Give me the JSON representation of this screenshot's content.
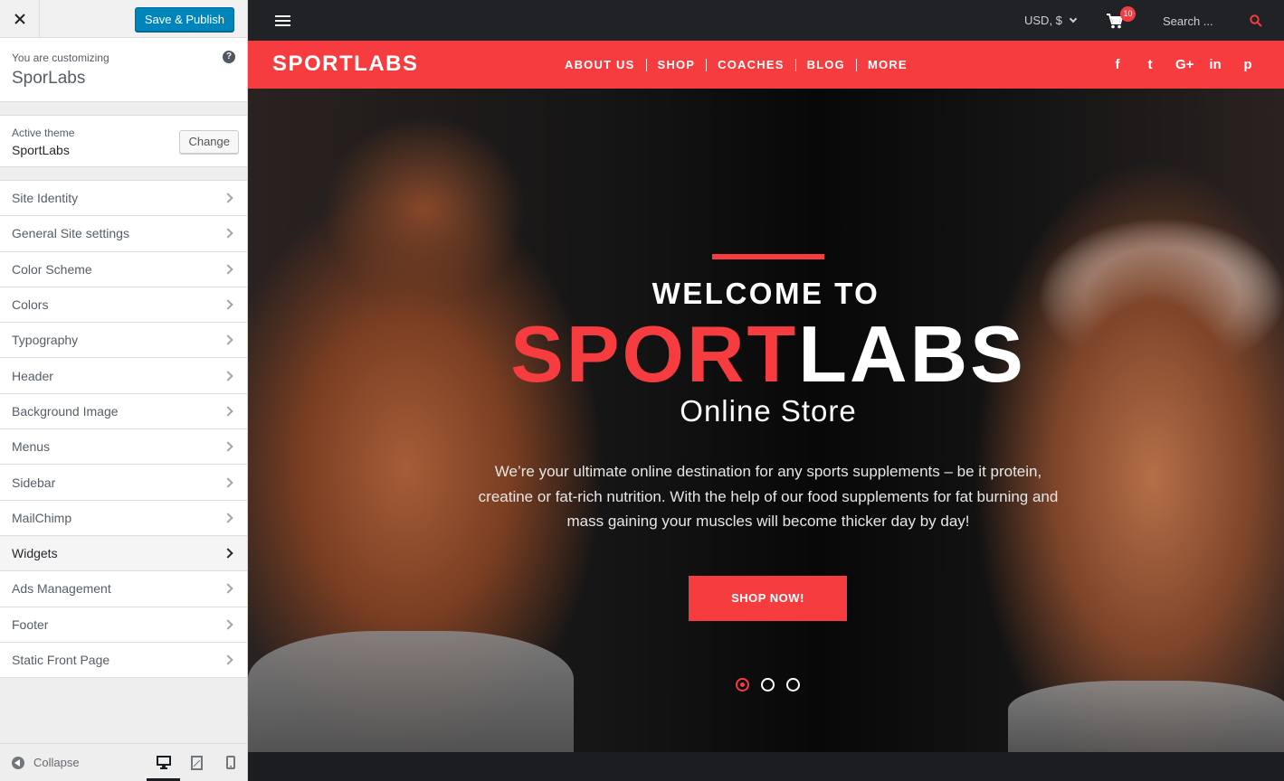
{
  "customizer": {
    "close_icon": "close-icon",
    "save_label": "Save & Publish",
    "customizing_label": "You are customizing",
    "site_name": "SporLabs",
    "help_glyph": "?",
    "active_theme_label": "Active theme",
    "theme_name": "SportLabs",
    "change_label": "Change",
    "sections": [
      {
        "label": "Site Identity"
      },
      {
        "label": "General Site settings"
      },
      {
        "label": "Color Scheme"
      },
      {
        "label": "Colors"
      },
      {
        "label": "Typography"
      },
      {
        "label": "Header"
      },
      {
        "label": "Background Image"
      },
      {
        "label": "Menus"
      },
      {
        "label": "Sidebar"
      },
      {
        "label": "MailChimp"
      },
      {
        "label": "Widgets"
      },
      {
        "label": "Ads Management"
      },
      {
        "label": "Footer"
      },
      {
        "label": "Static Front Page"
      }
    ],
    "active_section": "Widgets",
    "collapse_label": "Collapse",
    "devices": [
      "desktop-icon",
      "tablet-icon",
      "mobile-icon"
    ],
    "active_device": "desktop"
  },
  "site": {
    "currency": "USD, $",
    "cart_count": "10",
    "search_placeholder": "Search ...",
    "logo": "SPORTLABS",
    "menu": [
      {
        "label": "ABOUT US"
      },
      {
        "label": "SHOP"
      },
      {
        "label": "COACHES"
      },
      {
        "label": "BLOG"
      },
      {
        "label": "MORE"
      }
    ],
    "socials": [
      {
        "icon": "facebook-icon",
        "glyph": "f"
      },
      {
        "icon": "twitter-icon",
        "glyph": "t"
      },
      {
        "icon": "google-plus-icon",
        "glyph": "G+"
      },
      {
        "icon": "linkedin-icon",
        "glyph": "in"
      },
      {
        "icon": "pinterest-icon",
        "glyph": "p"
      }
    ],
    "hero": {
      "welcome": "WELCOME TO",
      "brand_red": "SPORT",
      "brand_white": "LABS",
      "subtitle": "Online Store",
      "description": "We’re your ultimate online destination for any sports supplements – be it protein, creatine or fat-rich nutrition. With the help of our food supplements for fat burning and mass gaining your muscles will become thicker day by day!",
      "cta": "SHOP NOW!",
      "slides": 3,
      "active_slide": 1
    }
  },
  "colors": {
    "accent": "#f63c3f",
    "wp_primary": "#0085ba",
    "topbar": "#202226"
  }
}
